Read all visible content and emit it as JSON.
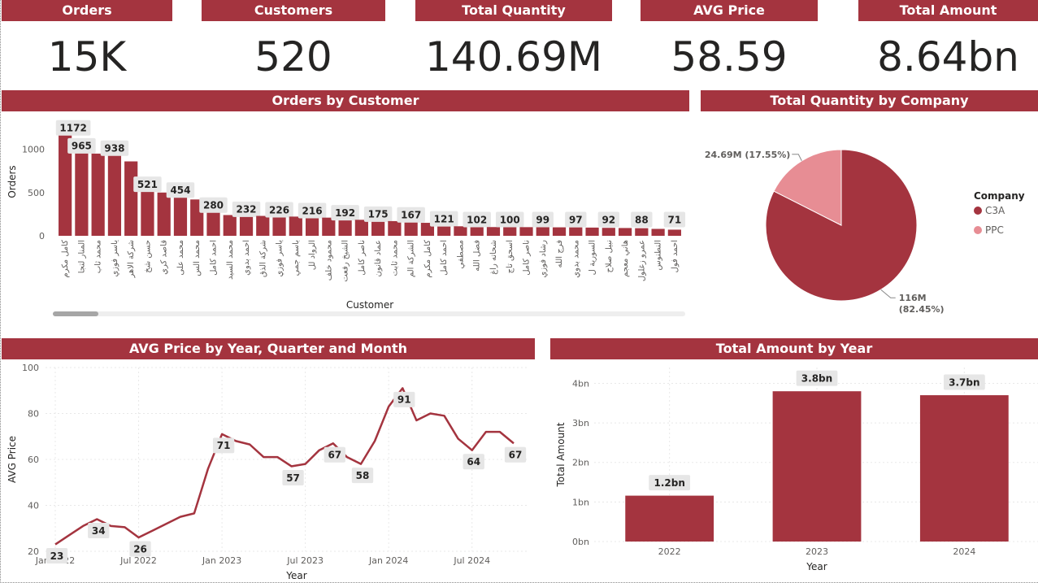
{
  "kpis": [
    {
      "label": "Orders",
      "value": "15K"
    },
    {
      "label": "Customers",
      "value": "520"
    },
    {
      "label": "Total Quantity",
      "value": "140.69M"
    },
    {
      "label": "AVG Price",
      "value": "58.59"
    },
    {
      "label": "Total Amount",
      "value": "8.64bn"
    }
  ],
  "colors": {
    "primary": "#a4343f",
    "secondary": "#e78d94",
    "label_bg": "#e6e6e6"
  },
  "chart_data": [
    {
      "id": "orders_by_customer",
      "type": "bar",
      "title": "Orders by Customer",
      "xlabel": "Customer",
      "ylabel": "Orders",
      "ylim": [
        0,
        1250
      ],
      "yticks": [
        0,
        500,
        1000
      ],
      "grid": false,
      "categories": [
        "كامل مكرم",
        "المنار لتجا",
        "محمد ثاب",
        "ياسر فوزي",
        "شركة الاهر",
        "حسن شخ",
        "قاصد كري",
        "محمد على",
        "محمد الس",
        "احمد كامل",
        "محمد السيد",
        "احمد بدوي",
        "شركة الذق",
        "ياسر فوزي",
        "باسم جمي",
        "الرواد لل",
        "محمود خلف",
        "الشيخ رفعت",
        "ناصر كامل",
        "عماد قانون",
        "محمد ثابت",
        "الشركة الم",
        "كامل مكرم",
        "احمد كامل",
        "مصطفي",
        "فضل الله",
        "شحاته راغ",
        "اسحق تاج",
        "ناصر كامل",
        "رشاد فوزي",
        "فرج الله",
        "محمد بدوي",
        "السورية ل",
        "نبيل صلاح",
        "هاني معجم",
        "عمرو زغلول",
        "النطنوس",
        "احمد فول"
      ],
      "values": [
        1172,
        965,
        950,
        938,
        860,
        521,
        500,
        454,
        420,
        280,
        240,
        232,
        230,
        226,
        222,
        216,
        210,
        192,
        185,
        175,
        170,
        167,
        150,
        121,
        110,
        102,
        101,
        100,
        100,
        99,
        98,
        97,
        95,
        92,
        90,
        88,
        80,
        71
      ],
      "data_labels": [
        "1172",
        "965",
        "",
        "938",
        "",
        "521",
        "",
        "454",
        "",
        "280",
        "",
        "232",
        "",
        "226",
        "",
        "216",
        "",
        "192",
        "",
        "175",
        "",
        "167",
        "",
        "121",
        "",
        "102",
        "",
        "100",
        "",
        "99",
        "",
        "97",
        "",
        "92",
        "",
        "88",
        "",
        "71"
      ]
    },
    {
      "id": "quantity_by_company",
      "type": "pie",
      "title": "Total Quantity by Company",
      "legend_title": "Company",
      "legend_position": "right",
      "slices": [
        {
          "name": "C3A",
          "value": 116,
          "label": "116M (82.45%)",
          "color": "#a4343f"
        },
        {
          "name": "PPC",
          "value": 24.69,
          "label": "24.69M (17.55%)",
          "color": "#e78d94"
        }
      ]
    },
    {
      "id": "avg_price_trend",
      "type": "line",
      "title": "AVG Price by Year, Quarter and Month",
      "xlabel": "Year",
      "ylabel": "AVG Price",
      "ylim": [
        20,
        100
      ],
      "yticks": [
        20,
        40,
        60,
        80,
        100
      ],
      "xticks": [
        {
          "label": "Jan 2022",
          "index": 0
        },
        {
          "label": "Jul 2022",
          "index": 6
        },
        {
          "label": "Jan 2023",
          "index": 12
        },
        {
          "label": "Jul 2023",
          "index": 18
        },
        {
          "label": "Jan 2024",
          "index": 24
        },
        {
          "label": "Jul 2024",
          "index": 30
        }
      ],
      "grid": true,
      "values": [
        23,
        27,
        31,
        34,
        31,
        30.5,
        26,
        29,
        32,
        35,
        36.5,
        56,
        71,
        68,
        66.5,
        61,
        61,
        57,
        58,
        64,
        67,
        61,
        58,
        68,
        83,
        91,
        77,
        80,
        79,
        69,
        64,
        72,
        72,
        67
      ],
      "data_labels": [
        {
          "index": 0,
          "text": "23"
        },
        {
          "index": 3,
          "text": "34"
        },
        {
          "index": 6,
          "text": "26"
        },
        {
          "index": 12,
          "text": "71"
        },
        {
          "index": 17,
          "text": "57"
        },
        {
          "index": 20,
          "text": "67"
        },
        {
          "index": 22,
          "text": "58"
        },
        {
          "index": 25,
          "text": "91"
        },
        {
          "index": 30,
          "text": "64"
        },
        {
          "index": 33,
          "text": "67"
        }
      ]
    },
    {
      "id": "amount_by_year",
      "type": "bar",
      "title": "Total Amount by Year",
      "xlabel": "Year",
      "ylabel": "Total Amount",
      "ylim": [
        0,
        4.4
      ],
      "yticks": [
        {
          "v": 0,
          "label": "0bn"
        },
        {
          "v": 1,
          "label": "1bn"
        },
        {
          "v": 2,
          "label": "2bn"
        },
        {
          "v": 3,
          "label": "3bn"
        },
        {
          "v": 4,
          "label": "4bn"
        }
      ],
      "grid": true,
      "categories": [
        "2022",
        "2023",
        "2024"
      ],
      "values": [
        1.16,
        3.8,
        3.7
      ],
      "data_labels": [
        "1.2bn",
        "3.8bn",
        "3.7bn"
      ]
    }
  ]
}
